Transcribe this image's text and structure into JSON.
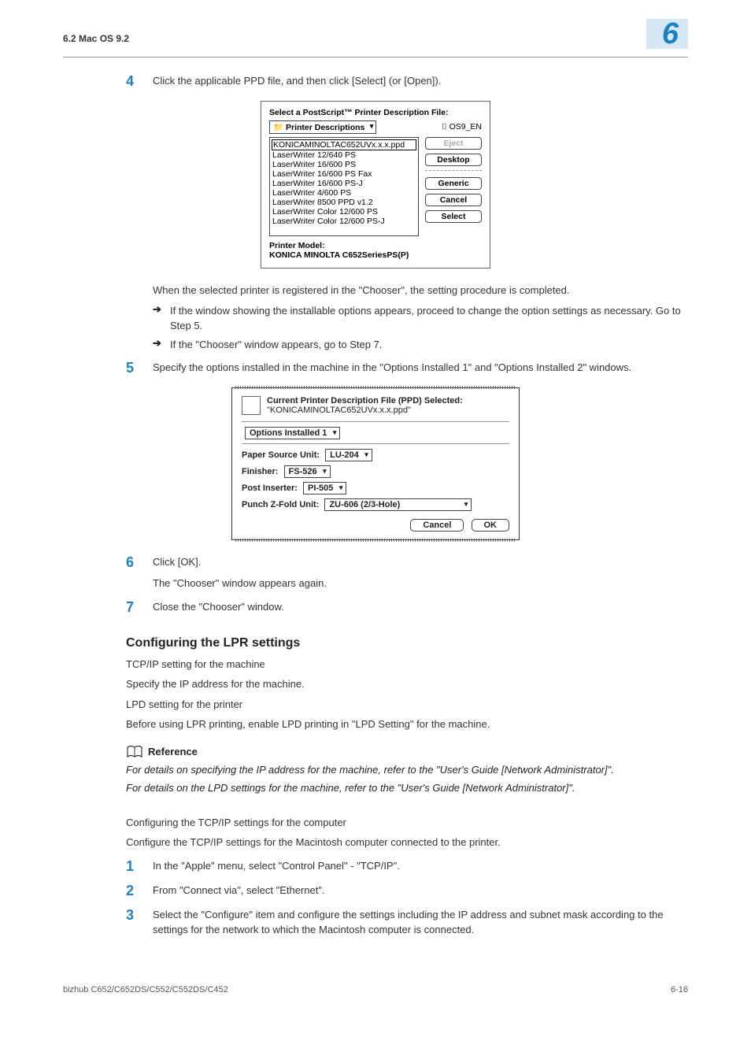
{
  "header": {
    "left": "6.2    Mac OS 9.2",
    "right": "6"
  },
  "steps_top": {
    "step4": {
      "num": "4",
      "text": "Click the applicable PPD file, and then click [Select] (or [Open])."
    }
  },
  "dialog1": {
    "title": "Select a PostScript™ Printer Description File:",
    "dropdown": "Printer Descriptions",
    "volume": "OS9_EN",
    "items": [
      "KONICAMINOLTAC652UVx.x.x.ppd",
      "LaserWriter 12/640 PS",
      "LaserWriter 16/600 PS",
      "LaserWriter 16/600 PS Fax",
      "LaserWriter 16/600 PS-J",
      "LaserWriter 4/600 PS",
      "LaserWriter 8500 PPD v1.2",
      "LaserWriter Color 12/600 PS",
      "LaserWriter Color 12/600 PS-J"
    ],
    "btn_eject": "Eject",
    "btn_desktop": "Desktop",
    "btn_generic": "Generic",
    "btn_cancel": "Cancel",
    "btn_select": "Select",
    "model_label": "Printer Model:",
    "model_value": "KONICA MINOLTA C652SeriesPS(P)"
  },
  "after_d1": {
    "line1": "When the selected printer is registered in the \"Chooser\", the setting procedure is completed.",
    "bullet1": "If the window showing the installable options appears, proceed to change the option settings as necessary. Go to Step 5.",
    "bullet2": "If the \"Chooser\" window appears, go to Step 7."
  },
  "step5": {
    "num": "5",
    "text": "Specify the options installed in the machine in the \"Options Installed 1\" and \"Options Installed 2\" windows."
  },
  "dialog2": {
    "title": "Current Printer Description File (PPD) Selected:",
    "subtitle": "\"KONICAMINOLTAC652UVx.x.x.ppd\"",
    "group": "Options Installed 1",
    "rows": {
      "paper_label": "Paper Source Unit:",
      "paper_value": "LU-204",
      "finisher_label": "Finisher:",
      "finisher_value": "FS-526",
      "post_label": "Post Inserter:",
      "post_value": "PI-505",
      "punch_label": "Punch Z-Fold Unit:",
      "punch_value": "ZU-606 (2/3-Hole)"
    },
    "cancel": "Cancel",
    "ok": "OK"
  },
  "step6": {
    "num": "6",
    "text": "Click [OK].",
    "sub": "The \"Chooser\" window appears again."
  },
  "step7": {
    "num": "7",
    "text": "Close the \"Chooser\" window."
  },
  "lpr": {
    "heading": "Configuring the LPR settings",
    "p1": "TCP/IP setting for the machine",
    "p2": "Specify the IP address for the machine.",
    "p3": "LPD setting for the printer",
    "p4": "Before using LPR printing, enable LPD printing in \"LPD Setting\" for the machine."
  },
  "reference": {
    "label": "Reference",
    "line1": "For details on specifying the IP address for the machine, refer to the \"User's Guide [Network Administrator]\".",
    "line2": "For details on the LPD settings for the machine, refer to the \"User's Guide [Network Administrator]\"."
  },
  "tcpip": {
    "heading": "Configuring the TCP/IP settings for the computer",
    "intro": "Configure the TCP/IP settings for the Macintosh computer connected to the printer.",
    "s1": {
      "num": "1",
      "text": "In the \"Apple\" menu, select \"Control Panel\" - \"TCP/IP\"."
    },
    "s2": {
      "num": "2",
      "text": "From \"Connect via\", select \"Ethernet\"."
    },
    "s3": {
      "num": "3",
      "text": "Select the \"Configure\" item and configure the settings including the IP address and subnet mask according to the settings for the network to which the Macintosh computer is connected."
    }
  },
  "footer": {
    "left": "bizhub C652/C652DS/C552/C552DS/C452",
    "right": "6-16"
  }
}
